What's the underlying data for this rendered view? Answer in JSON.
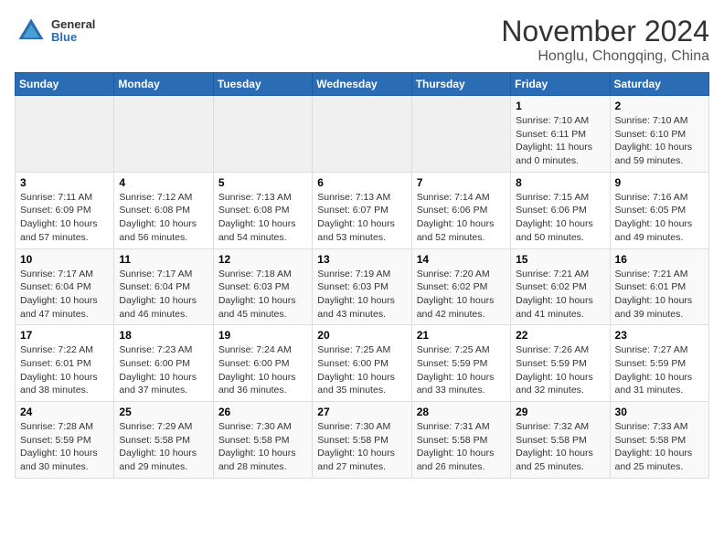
{
  "header": {
    "logo": {
      "general": "General",
      "blue": "Blue"
    },
    "title": "November 2024",
    "subtitle": "Honglu, Chongqing, China"
  },
  "calendar": {
    "weekdays": [
      "Sunday",
      "Monday",
      "Tuesday",
      "Wednesday",
      "Thursday",
      "Friday",
      "Saturday"
    ],
    "weeks": [
      [
        {
          "day": "",
          "empty": true
        },
        {
          "day": "",
          "empty": true
        },
        {
          "day": "",
          "empty": true
        },
        {
          "day": "",
          "empty": true
        },
        {
          "day": "",
          "empty": true
        },
        {
          "day": "1",
          "sunrise": "Sunrise: 7:10 AM",
          "sunset": "Sunset: 6:11 PM",
          "daylight": "Daylight: 11 hours and 0 minutes."
        },
        {
          "day": "2",
          "sunrise": "Sunrise: 7:10 AM",
          "sunset": "Sunset: 6:10 PM",
          "daylight": "Daylight: 10 hours and 59 minutes."
        }
      ],
      [
        {
          "day": "3",
          "sunrise": "Sunrise: 7:11 AM",
          "sunset": "Sunset: 6:09 PM",
          "daylight": "Daylight: 10 hours and 57 minutes."
        },
        {
          "day": "4",
          "sunrise": "Sunrise: 7:12 AM",
          "sunset": "Sunset: 6:08 PM",
          "daylight": "Daylight: 10 hours and 56 minutes."
        },
        {
          "day": "5",
          "sunrise": "Sunrise: 7:13 AM",
          "sunset": "Sunset: 6:08 PM",
          "daylight": "Daylight: 10 hours and 54 minutes."
        },
        {
          "day": "6",
          "sunrise": "Sunrise: 7:13 AM",
          "sunset": "Sunset: 6:07 PM",
          "daylight": "Daylight: 10 hours and 53 minutes."
        },
        {
          "day": "7",
          "sunrise": "Sunrise: 7:14 AM",
          "sunset": "Sunset: 6:06 PM",
          "daylight": "Daylight: 10 hours and 52 minutes."
        },
        {
          "day": "8",
          "sunrise": "Sunrise: 7:15 AM",
          "sunset": "Sunset: 6:06 PM",
          "daylight": "Daylight: 10 hours and 50 minutes."
        },
        {
          "day": "9",
          "sunrise": "Sunrise: 7:16 AM",
          "sunset": "Sunset: 6:05 PM",
          "daylight": "Daylight: 10 hours and 49 minutes."
        }
      ],
      [
        {
          "day": "10",
          "sunrise": "Sunrise: 7:17 AM",
          "sunset": "Sunset: 6:04 PM",
          "daylight": "Daylight: 10 hours and 47 minutes."
        },
        {
          "day": "11",
          "sunrise": "Sunrise: 7:17 AM",
          "sunset": "Sunset: 6:04 PM",
          "daylight": "Daylight: 10 hours and 46 minutes."
        },
        {
          "day": "12",
          "sunrise": "Sunrise: 7:18 AM",
          "sunset": "Sunset: 6:03 PM",
          "daylight": "Daylight: 10 hours and 45 minutes."
        },
        {
          "day": "13",
          "sunrise": "Sunrise: 7:19 AM",
          "sunset": "Sunset: 6:03 PM",
          "daylight": "Daylight: 10 hours and 43 minutes."
        },
        {
          "day": "14",
          "sunrise": "Sunrise: 7:20 AM",
          "sunset": "Sunset: 6:02 PM",
          "daylight": "Daylight: 10 hours and 42 minutes."
        },
        {
          "day": "15",
          "sunrise": "Sunrise: 7:21 AM",
          "sunset": "Sunset: 6:02 PM",
          "daylight": "Daylight: 10 hours and 41 minutes."
        },
        {
          "day": "16",
          "sunrise": "Sunrise: 7:21 AM",
          "sunset": "Sunset: 6:01 PM",
          "daylight": "Daylight: 10 hours and 39 minutes."
        }
      ],
      [
        {
          "day": "17",
          "sunrise": "Sunrise: 7:22 AM",
          "sunset": "Sunset: 6:01 PM",
          "daylight": "Daylight: 10 hours and 38 minutes."
        },
        {
          "day": "18",
          "sunrise": "Sunrise: 7:23 AM",
          "sunset": "Sunset: 6:00 PM",
          "daylight": "Daylight: 10 hours and 37 minutes."
        },
        {
          "day": "19",
          "sunrise": "Sunrise: 7:24 AM",
          "sunset": "Sunset: 6:00 PM",
          "daylight": "Daylight: 10 hours and 36 minutes."
        },
        {
          "day": "20",
          "sunrise": "Sunrise: 7:25 AM",
          "sunset": "Sunset: 6:00 PM",
          "daylight": "Daylight: 10 hours and 35 minutes."
        },
        {
          "day": "21",
          "sunrise": "Sunrise: 7:25 AM",
          "sunset": "Sunset: 5:59 PM",
          "daylight": "Daylight: 10 hours and 33 minutes."
        },
        {
          "day": "22",
          "sunrise": "Sunrise: 7:26 AM",
          "sunset": "Sunset: 5:59 PM",
          "daylight": "Daylight: 10 hours and 32 minutes."
        },
        {
          "day": "23",
          "sunrise": "Sunrise: 7:27 AM",
          "sunset": "Sunset: 5:59 PM",
          "daylight": "Daylight: 10 hours and 31 minutes."
        }
      ],
      [
        {
          "day": "24",
          "sunrise": "Sunrise: 7:28 AM",
          "sunset": "Sunset: 5:59 PM",
          "daylight": "Daylight: 10 hours and 30 minutes."
        },
        {
          "day": "25",
          "sunrise": "Sunrise: 7:29 AM",
          "sunset": "Sunset: 5:58 PM",
          "daylight": "Daylight: 10 hours and 29 minutes."
        },
        {
          "day": "26",
          "sunrise": "Sunrise: 7:30 AM",
          "sunset": "Sunset: 5:58 PM",
          "daylight": "Daylight: 10 hours and 28 minutes."
        },
        {
          "day": "27",
          "sunrise": "Sunrise: 7:30 AM",
          "sunset": "Sunset: 5:58 PM",
          "daylight": "Daylight: 10 hours and 27 minutes."
        },
        {
          "day": "28",
          "sunrise": "Sunrise: 7:31 AM",
          "sunset": "Sunset: 5:58 PM",
          "daylight": "Daylight: 10 hours and 26 minutes."
        },
        {
          "day": "29",
          "sunrise": "Sunrise: 7:32 AM",
          "sunset": "Sunset: 5:58 PM",
          "daylight": "Daylight: 10 hours and 25 minutes."
        },
        {
          "day": "30",
          "sunrise": "Sunrise: 7:33 AM",
          "sunset": "Sunset: 5:58 PM",
          "daylight": "Daylight: 10 hours and 25 minutes."
        }
      ]
    ]
  }
}
